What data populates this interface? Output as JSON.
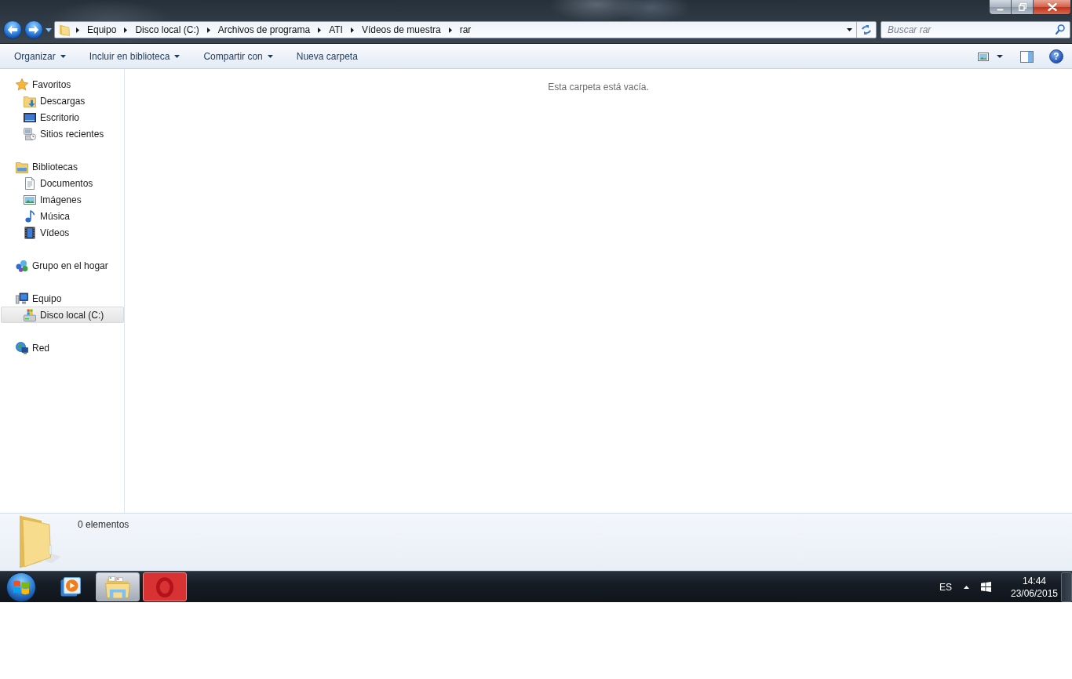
{
  "address_bar": {
    "breadcrumbs": [
      "Equipo",
      "Disco local (C:)",
      "Archivos de programa",
      "ATI",
      "Vídeos de muestra",
      "rar"
    ]
  },
  "search": {
    "placeholder": "Buscar rar"
  },
  "toolbar": {
    "buttons": [
      {
        "label": "Organizar",
        "has_menu": true
      },
      {
        "label": "Incluir en biblioteca",
        "has_menu": true
      },
      {
        "label": "Compartir con",
        "has_menu": true
      },
      {
        "label": "Nueva carpeta",
        "has_menu": false
      }
    ],
    "help_symbol": "?"
  },
  "sidebar": {
    "groups": [
      {
        "label": "Favoritos",
        "kind": "favorites",
        "selected": false,
        "children": [
          {
            "label": "Descargas",
            "kind": "downloads",
            "selected": false
          },
          {
            "label": "Escritorio",
            "kind": "desktop",
            "selected": false
          },
          {
            "label": "Sitios recientes",
            "kind": "recent",
            "selected": false
          }
        ]
      },
      {
        "label": "Bibliotecas",
        "kind": "libraries",
        "selected": false,
        "children": [
          {
            "label": "Documentos",
            "kind": "documents",
            "selected": false
          },
          {
            "label": "Imágenes",
            "kind": "pictures",
            "selected": false
          },
          {
            "label": "Música",
            "kind": "music",
            "selected": false
          },
          {
            "label": "Vídeos",
            "kind": "videos",
            "selected": false
          }
        ]
      },
      {
        "label": "Grupo en el hogar",
        "kind": "homegroup",
        "selected": false
      },
      {
        "label": "Equipo",
        "kind": "computer",
        "selected": false,
        "children": [
          {
            "label": "Disco local (C:)",
            "kind": "drive",
            "selected": true
          }
        ]
      },
      {
        "label": "Red",
        "kind": "network",
        "selected": false
      }
    ]
  },
  "content": {
    "empty_message": "Esta carpeta está vacía."
  },
  "details_pane": {
    "item_count": "0 elementos"
  },
  "taskbar": {
    "apps": [
      {
        "kind": "media-player",
        "open": false,
        "active": false,
        "hovered": false
      },
      {
        "kind": "explorer",
        "open": true,
        "active": true,
        "hovered": false
      },
      {
        "kind": "browser",
        "open": true,
        "active": false,
        "hovered": true
      }
    ],
    "language": "ES",
    "time": "14:44",
    "date": "23/06/2015"
  }
}
